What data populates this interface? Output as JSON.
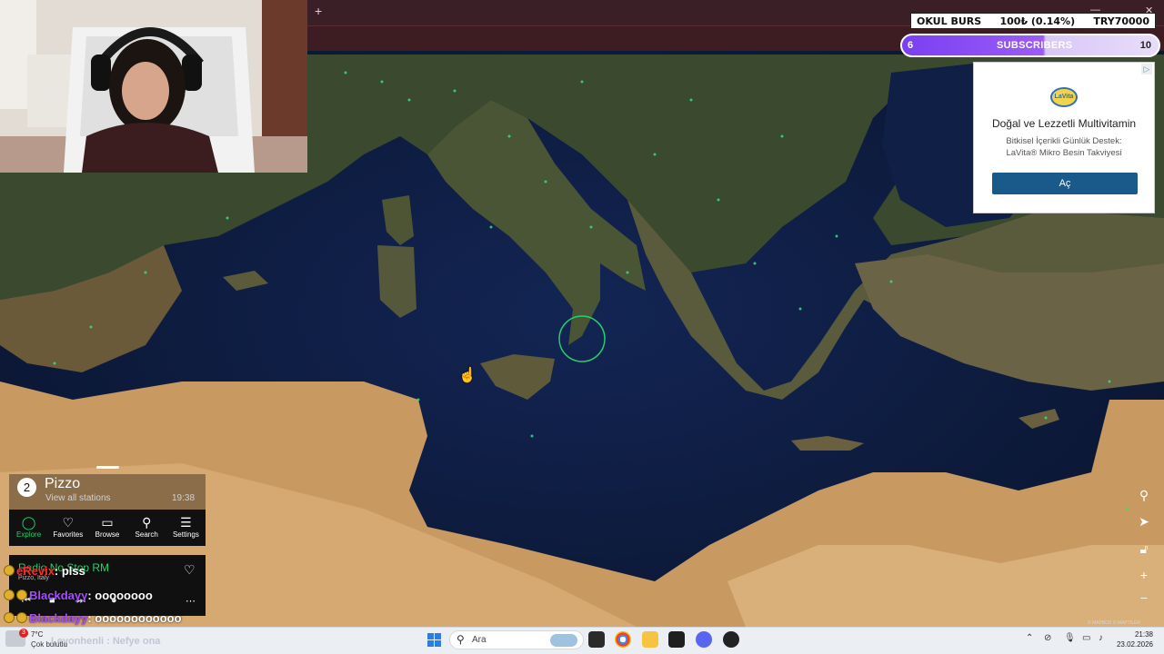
{
  "browser": {
    "new_tab": "+",
    "minimize": "—",
    "close": "✕"
  },
  "overlay": {
    "okul_label": "OKUL BURS",
    "okul_amount": "100₺ (0.14%)",
    "okul_target": "TRY70000",
    "subs_left": "6",
    "subs_label": "SUBSCRIBERS",
    "subs_right": "10"
  },
  "ad": {
    "logo": "LaVita",
    "title": "Doğal ve Lezzetli Multivitamin",
    "desc_line1": "Bitkisel İçerikli Günlük Destek:",
    "desc_line2": "LaVita® Mikro Besin Takviyesi",
    "button": "Aç",
    "adchoice": "▷"
  },
  "radio": {
    "count": "2",
    "place": "Pizzo",
    "view_all": "View all stations",
    "time": "19:38",
    "nav": [
      {
        "label": "Explore",
        "icon": "explore-icon"
      },
      {
        "label": "Favorites",
        "icon": "heart-icon"
      },
      {
        "label": "Browse",
        "icon": "map-icon"
      },
      {
        "label": "Search",
        "icon": "search-icon"
      },
      {
        "label": "Settings",
        "icon": "menu-icon"
      }
    ],
    "station": "Radio No Stop RM",
    "station_location": "Pizzo, Italy"
  },
  "chat": [
    {
      "user": "eRevix",
      "msg": ": plss"
    },
    {
      "user": "Blackdayy",
      "msg": ": oooooooo"
    },
    {
      "user": "Blackdayy",
      "msg": ": oooooooooooo"
    }
  ],
  "taskbar": {
    "temp": "7°C",
    "weather": "Çok bulutlu",
    "weather_badge": "3",
    "ghost_text": "Leyonhenli : Nefye ona",
    "search_placeholder": "Ara",
    "time": "21:38",
    "date": "23.02.2026"
  },
  "map_attribution": "© MAPBOX © MAPTILER",
  "colors": {
    "accent_green": "#27d16a",
    "subs_purple": "#7a3ff2",
    "ad_button": "#1a5a8a",
    "chat_purple": "#a64dff"
  }
}
